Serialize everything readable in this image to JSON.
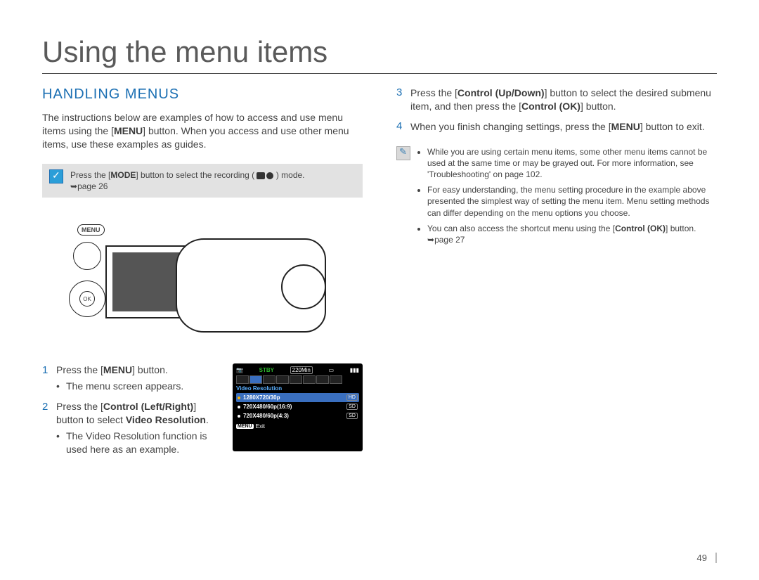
{
  "page": {
    "title": "Using the menu items",
    "number": "49"
  },
  "section": {
    "heading": "HANDLING MENUS",
    "intro_a": "The instructions below are examples of how to access and use menu items using the [",
    "intro_menu": "MENU",
    "intro_b": "] button. When you access and use other menu items, use these examples as guides."
  },
  "note": {
    "text_a": "Press the [",
    "text_mode": "MODE",
    "text_b": "] button to select the recording (",
    "text_c": ") mode.",
    "page_ref": "page 26"
  },
  "illustration": {
    "menu_label": "MENU",
    "ok_label": "OK"
  },
  "steps": {
    "s1": {
      "num": "1",
      "text_a": "Press the [",
      "text_menu": "MENU",
      "text_b": "] button.",
      "sub": "The menu screen appears."
    },
    "s2": {
      "num": "2",
      "text_a": "Press the [",
      "text_ctrl": "Control (Left/Right)",
      "text_b": "] button to select ",
      "text_target": "Video Resolution",
      "text_c": ".",
      "sub": "The Video Resolution function is used here as an example."
    },
    "s3": {
      "num": "3",
      "text_a": "Press the [",
      "text_ctrl": "Control (Up/Down)",
      "text_b": "] button to select the desired submenu item, and then press the [",
      "text_ok": "Control (OK)",
      "text_c": "] button."
    },
    "s4": {
      "num": "4",
      "text_a": "When you finish changing settings, press the [",
      "text_menu": "MENU",
      "text_b": "] button to exit."
    }
  },
  "osd": {
    "stby": "STBY",
    "time": "220Min",
    "title": "Video Resolution",
    "rows": {
      "r1": {
        "res": "1280X720/30p",
        "tag": "HD"
      },
      "r2": {
        "res": "720X480/60p(16:9)",
        "tag": "SD"
      },
      "r3": {
        "res": "720X480/60p(4:3)",
        "tag": "SD"
      }
    },
    "menu_badge": "MENU",
    "exit": "Exit"
  },
  "tips": {
    "t1": "While you are using certain menu items, some other menu items cannot be used at the same time or may be grayed out. For more information, see 'Troubleshooting' on page 102.",
    "t2": "For easy understanding, the menu setting procedure in the example above presented the simplest way of setting the menu item. Menu setting methods can differ depending on the menu options you choose.",
    "t3_a": "You can also access the shortcut menu using the [",
    "t3_ctrl": "Control (OK)",
    "t3_b": "] button. ",
    "t3_ref": "page 27"
  }
}
